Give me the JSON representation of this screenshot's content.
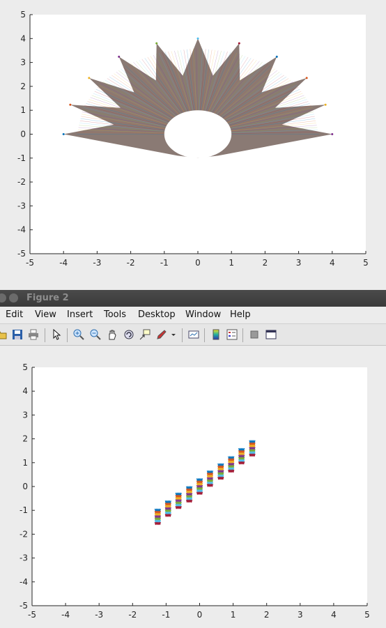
{
  "figure1": {
    "chart_data": {
      "type": "line",
      "title": "",
      "xlabel": "",
      "ylabel": "",
      "xlim": [
        -5,
        5
      ],
      "ylim": [
        -5,
        5
      ],
      "xticks": [
        -5,
        -4,
        -3,
        -2,
        -1,
        0,
        1,
        2,
        3,
        4,
        5
      ],
      "yticks": [
        -5,
        -4,
        -3,
        -2,
        -1,
        0,
        1,
        2,
        3,
        4,
        5
      ],
      "grid": false,
      "description_data": {
        "outer_star_vertices": [
          [
            -4.0,
            0.0
          ],
          [
            -3.8,
            1.23
          ],
          [
            -3.24,
            2.35
          ],
          [
            -2.35,
            3.24
          ],
          [
            -1.23,
            3.8
          ],
          [
            0.0,
            4.0
          ],
          [
            1.23,
            3.8
          ],
          [
            2.35,
            3.24
          ],
          [
            3.24,
            2.35
          ],
          [
            3.8,
            1.23
          ],
          [
            4.0,
            0.0
          ]
        ],
        "inner_star_vertices": [
          [
            -2.5,
            0.4
          ],
          [
            -2.3,
            1.1
          ],
          [
            -1.9,
            1.75
          ],
          [
            -1.25,
            2.25
          ],
          [
            -0.45,
            2.45
          ],
          [
            0.45,
            2.45
          ],
          [
            1.25,
            2.25
          ],
          [
            1.9,
            1.75
          ],
          [
            2.3,
            1.1
          ],
          [
            2.5,
            0.4
          ]
        ],
        "hole_center": [
          0,
          0
        ],
        "hole_rx": 1.0,
        "hole_ry": 1.0
      }
    }
  },
  "figure2": {
    "window_title": "Figure 2",
    "menu": [
      "Edit",
      "View",
      "Insert",
      "Tools",
      "Desktop",
      "Window",
      "Help"
    ],
    "chart_data": {
      "type": "scatter",
      "title": "",
      "xlabel": "",
      "ylabel": "",
      "xlim": [
        -5,
        5
      ],
      "ylim": [
        -5,
        5
      ],
      "xticks": [
        -5,
        -4,
        -3,
        -2,
        -1,
        0,
        1,
        2,
        3,
        4,
        5
      ],
      "yticks": [
        -5,
        -4,
        -3,
        -2,
        -1,
        0,
        1,
        2,
        3,
        4,
        5
      ],
      "grid": false,
      "clusters": [
        {
          "x": -1.25,
          "y": -1.27
        },
        {
          "x": -0.94,
          "y": -0.93
        },
        {
          "x": -0.63,
          "y": -0.6
        },
        {
          "x": -0.31,
          "y": -0.33
        },
        {
          "x": 0.0,
          "y": 0.0
        },
        {
          "x": 0.31,
          "y": 0.33
        },
        {
          "x": 0.63,
          "y": 0.63
        },
        {
          "x": 0.94,
          "y": 0.93
        },
        {
          "x": 1.25,
          "y": 1.27
        },
        {
          "x": 1.57,
          "y": 1.6
        }
      ],
      "colors": [
        "#0072bd",
        "#d95319",
        "#edb120",
        "#7e2f8e",
        "#77ac30",
        "#4dbeee",
        "#a2142f"
      ]
    }
  }
}
